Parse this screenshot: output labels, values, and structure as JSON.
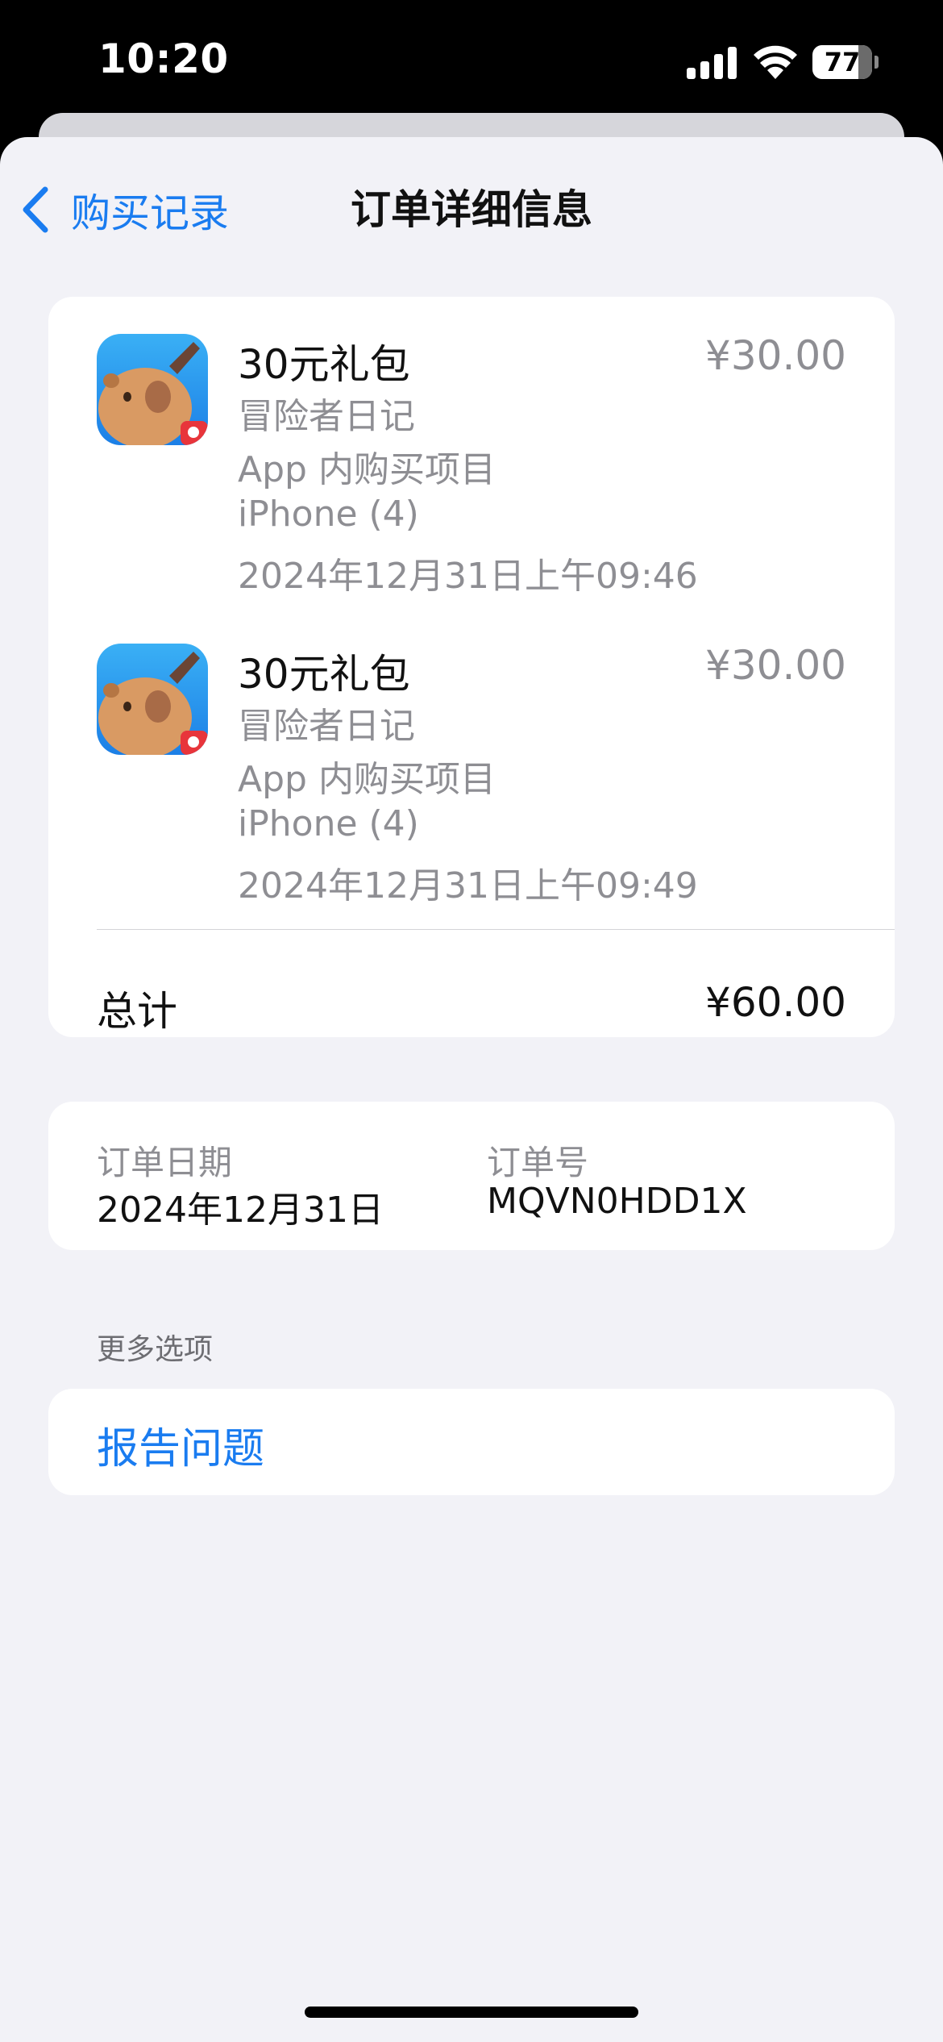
{
  "status": {
    "time": "10:20",
    "battery": "77",
    "battery_level": 0.77
  },
  "nav": {
    "back_label": "购买记录",
    "title": "订单详细信息"
  },
  "items": [
    {
      "name": "30元礼包",
      "price": "¥30.00",
      "app": "冒险者日记",
      "type": "App 内购买项目",
      "device": "iPhone (4)",
      "datetime": "2024年12月31日上午09:46",
      "icon": "capybara-game-icon"
    },
    {
      "name": "30元礼包",
      "price": "¥30.00",
      "app": "冒险者日记",
      "type": "App 内购买项目",
      "device": "iPhone (4)",
      "datetime": "2024年12月31日上午09:49",
      "icon": "capybara-game-icon"
    }
  ],
  "total": {
    "label": "总计",
    "value": "¥60.00"
  },
  "order": {
    "date_label": "订单日期",
    "date_value": "2024年12月31日",
    "id_label": "订单号",
    "id_value": "MQVN0HDD1X"
  },
  "more_options": {
    "header": "更多选项",
    "report_label": "报告问题"
  },
  "colors": {
    "accent": "#1a7cf0",
    "background": "#f2f2f7",
    "secondary_text": "#8e8e93"
  }
}
